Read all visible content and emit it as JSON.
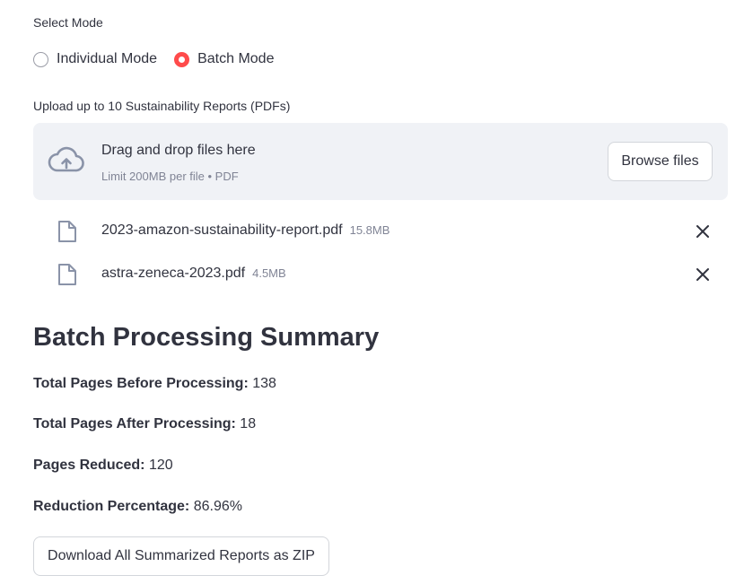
{
  "mode": {
    "label": "Select Mode",
    "options": [
      {
        "label": "Individual Mode",
        "selected": false
      },
      {
        "label": "Batch Mode",
        "selected": true
      }
    ]
  },
  "uploader": {
    "label": "Upload up to 10 Sustainability Reports (PDFs)",
    "drop_title": "Drag and drop files here",
    "limit_text": "Limit 200MB per file • PDF",
    "browse_label": "Browse files",
    "icon": "cloud-upload-icon"
  },
  "files": [
    {
      "name": "2023-amazon-sustainability-report.pdf",
      "size": "15.8MB"
    },
    {
      "name": "astra-zeneca-2023.pdf",
      "size": "4.5MB"
    }
  ],
  "summary": {
    "title": "Batch Processing Summary",
    "stats": [
      {
        "label": "Total Pages Before Processing:",
        "value": "138"
      },
      {
        "label": "Total Pages After Processing:",
        "value": "18"
      },
      {
        "label": "Pages Reduced:",
        "value": "120"
      },
      {
        "label": "Reduction Percentage:",
        "value": "86.96%"
      }
    ]
  },
  "download_label": "Download All Summarized Reports as ZIP",
  "colors": {
    "accent": "#ff4b4b",
    "dropzone_bg": "#f0f2f6",
    "text": "#31333f",
    "muted": "#808495"
  }
}
